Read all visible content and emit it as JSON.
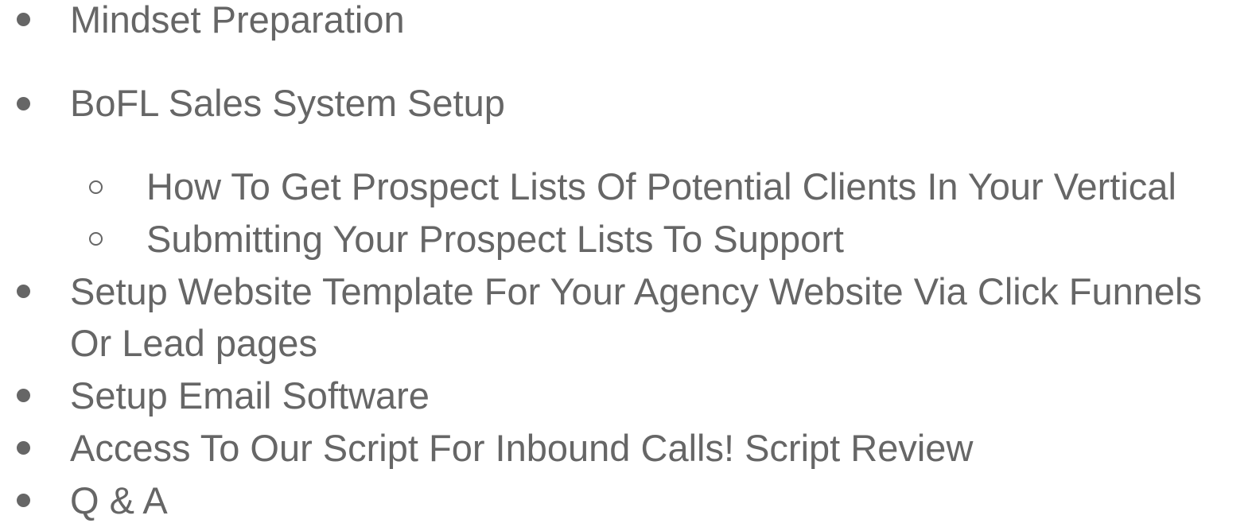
{
  "outline": {
    "item_1": "Mindset Preparation",
    "item_2": "BoFL Sales System Setup",
    "sub_1": "How To Get Prospect Lists Of Potential Clients In Your Vertical",
    "sub_2": "Submitting Your Prospect Lists To Support",
    "item_3_line_1": "Setup Website Template For Your Agency Website Via Click Funnels",
    "item_3_line_2": "Or Lead pages",
    "item_4": "Setup Email Software",
    "item_5": "Access To Our Script For Inbound Calls! Script Review",
    "item_6": "Q & A"
  }
}
